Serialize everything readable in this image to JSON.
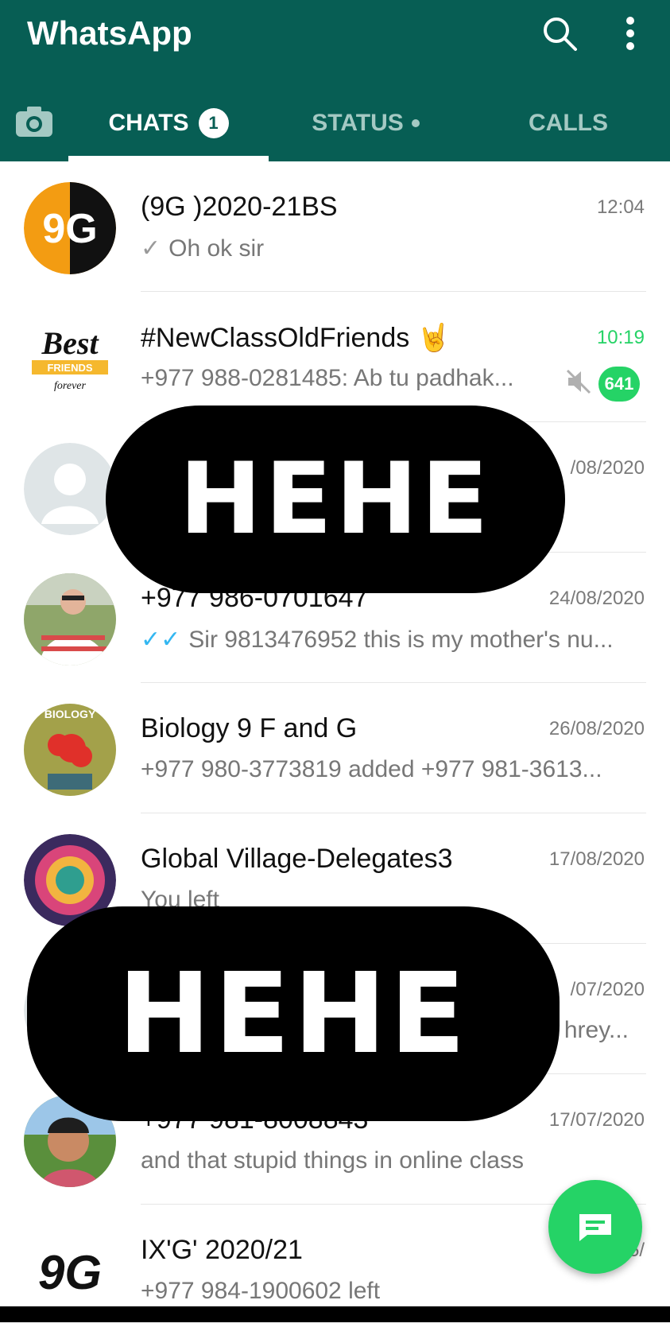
{
  "app": {
    "title": "WhatsApp",
    "colors": {
      "header": "#075e54",
      "accent": "#25d366",
      "tab_inactive": "#a4c9c3"
    }
  },
  "tabs": [
    {
      "label": "CHATS",
      "badge": "1",
      "active": true
    },
    {
      "label": "STATUS",
      "active": false
    },
    {
      "label": "CALLS",
      "active": false
    }
  ],
  "chats": [
    {
      "name": "(9G )2020-21BS",
      "time": "12:04",
      "preview": "Oh ok sir",
      "tick": "✓",
      "avatar_icon": "9g-logo-icon"
    },
    {
      "name": "#NewClassOldFriends 🤘",
      "time": "10:19",
      "preview": "+977 988-0281485: Ab tu padhak...",
      "unread": "641",
      "muted": true,
      "avatar_icon": "best-friends-forever-icon"
    },
    {
      "name": "",
      "time": "/08/2020",
      "preview": "",
      "avatar_icon": "default-profile-icon"
    },
    {
      "name": "+977 986-0701647",
      "time": "24/08/2020",
      "preview": "Sir 9813476952 this is my mother's nu...",
      "tick": "✓✓",
      "avatar_icon": "man-photo-icon"
    },
    {
      "name": "Biology 9 F and G",
      "time": "26/08/2020",
      "preview": "+977 980-3773819 added +977 981-3613...",
      "avatar_icon": "flower-photo-icon"
    },
    {
      "name": "Global Village-Delegates3",
      "time": "17/08/2020",
      "preview": "You left",
      "avatar_icon": "global-village-logo-icon"
    },
    {
      "name": "",
      "time": "/07/2020",
      "preview": "hrey...",
      "avatar_icon": "hidden-avatar-icon"
    },
    {
      "name": "+977 981-8008843",
      "time": "17/07/2020",
      "preview": "and that stupid things in online class",
      "avatar_icon": "boy-photo-icon"
    },
    {
      "name": "IX'G' 2020/21",
      "time": "25/",
      "preview": "+977 984-1900602 left",
      "avatar_icon": "9g-black-logo-icon"
    }
  ],
  "overlays": [
    {
      "text": "HEHE"
    },
    {
      "text": "HEHE"
    }
  ]
}
